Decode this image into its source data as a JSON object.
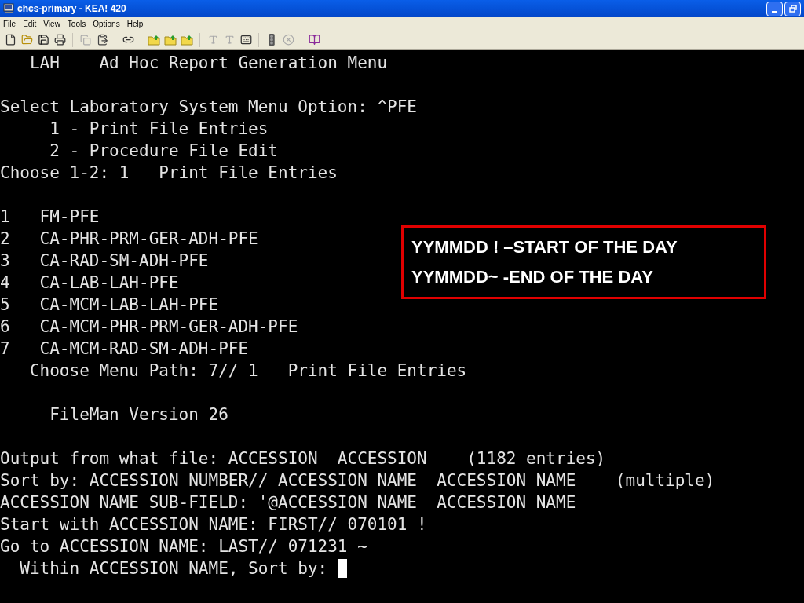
{
  "window": {
    "title": "chcs-primary - KEA! 420"
  },
  "menu": [
    "File",
    "Edit",
    "View",
    "Tools",
    "Options",
    "Help"
  ],
  "terminal": {
    "lines": [
      {
        "kind": "text",
        "text": "   LAH    Ad Hoc Report Generation Menu"
      },
      {
        "kind": "blank"
      },
      {
        "kind": "text",
        "text": "Select Laboratory System Menu Option: ^PFE"
      },
      {
        "kind": "text",
        "text": "     1 - Print File Entries"
      },
      {
        "kind": "text",
        "text": "     2 - Procedure File Edit"
      },
      {
        "kind": "text",
        "text": "Choose 1-2: 1   Print File Entries"
      },
      {
        "kind": "blank"
      },
      {
        "kind": "text",
        "text": "1   FM-PFE"
      },
      {
        "kind": "text",
        "text": "2   CA-PHR-PRM-GER-ADH-PFE"
      },
      {
        "kind": "text",
        "text": "3   CA-RAD-SM-ADH-PFE"
      },
      {
        "kind": "text",
        "text": "4   CA-LAB-LAH-PFE"
      },
      {
        "kind": "text",
        "text": "5   CA-MCM-LAB-LAH-PFE"
      },
      {
        "kind": "text",
        "text": "6   CA-MCM-PHR-PRM-GER-ADH-PFE"
      },
      {
        "kind": "text",
        "text": "7   CA-MCM-RAD-SM-ADH-PFE"
      },
      {
        "kind": "text",
        "text": "   Choose Menu Path: 7// 1   Print File Entries"
      },
      {
        "kind": "blank"
      },
      {
        "kind": "text",
        "text": "     FileMan Version 26"
      },
      {
        "kind": "blank"
      },
      {
        "kind": "text",
        "text": "Output from what file: ACCESSION  ACCESSION    (1182 entries)"
      },
      {
        "kind": "text",
        "text": "Sort by: ACCESSION NUMBER// ACCESSION NAME  ACCESSION NAME    (multiple)"
      },
      {
        "kind": "text",
        "text": "ACCESSION NAME SUB-FIELD: '@ACCESSION NAME  ACCESSION NAME"
      },
      {
        "kind": "text",
        "text": "Start with ACCESSION NAME: FIRST// 070101 !"
      },
      {
        "kind": "text",
        "text": "Go to ACCESSION NAME: LAST// 071231 ~"
      },
      {
        "kind": "prompt",
        "text": "  Within ACCESSION NAME, Sort by: "
      }
    ]
  },
  "callout": [
    "YYMMDD ! –START OF THE DAY",
    "YYMMDD~ -END OF THE DAY"
  ]
}
